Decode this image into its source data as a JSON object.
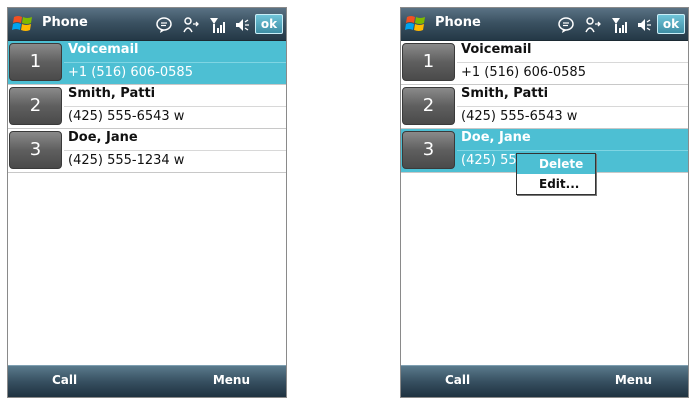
{
  "left": {
    "title": "Phone",
    "ok_label": "ok",
    "contacts": [
      {
        "number": "1",
        "name": "Voicemail",
        "phone": "+1 (516) 606-0585",
        "selected": true
      },
      {
        "number": "2",
        "name": "Smith, Patti",
        "phone": "(425) 555-6543 w",
        "selected": false
      },
      {
        "number": "3",
        "name": "Doe, Jane",
        "phone": "(425) 555-1234 w",
        "selected": false
      }
    ],
    "softkeys": {
      "left": "Call",
      "right": "Menu"
    }
  },
  "right": {
    "title": "Phone",
    "ok_label": "ok",
    "contacts": [
      {
        "number": "1",
        "name": "Voicemail",
        "phone": "+1 (516) 606-0585",
        "selected": false
      },
      {
        "number": "2",
        "name": "Smith, Patti",
        "phone": "(425) 555-6543 w",
        "selected": false
      },
      {
        "number": "3",
        "name": "Doe, Jane",
        "phone": "(425) 55",
        "selected": true
      }
    ],
    "context_menu": [
      "Delete",
      "Edit..."
    ],
    "softkeys": {
      "left": "Call",
      "right": "Menu"
    }
  },
  "icons": [
    "windows-start-icon",
    "notification-icon",
    "connectivity-icon",
    "signal-icon",
    "speaker-icon"
  ],
  "colors": {
    "accent": "#4dbfd3",
    "title_bar": "#3b5262"
  }
}
